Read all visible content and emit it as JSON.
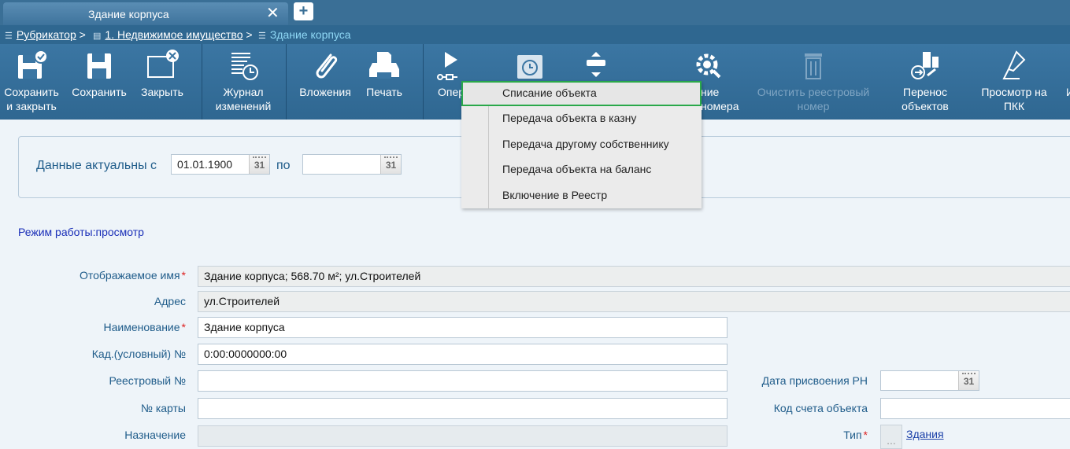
{
  "tab": {
    "title": "Здание корпуса",
    "close": "✕",
    "add": "+"
  },
  "breadcrumb": [
    {
      "label": "Рубрикатор",
      "sep": ">"
    },
    {
      "label": "1. Недвижимое имущество",
      "sep": ">"
    },
    {
      "label": "Здание корпуса"
    }
  ],
  "toolbar": {
    "save_close": "Сохранить\nи закрыть",
    "save": "Сохранить",
    "close": "Закрыть",
    "journal": "Журнал\nизменений",
    "attachments": "Вложения",
    "print": "Печать",
    "operations": "Опер",
    "assign_number": "ние\nномера",
    "clear_number": "Очистить реестровый\nномер",
    "move_objects": "Перенос\nобъектов",
    "view_pkk": "Просмотр на\nПКК",
    "more": "И"
  },
  "filter": {
    "label": "Данные актуальны с",
    "from_value": "01.01.1900",
    "to_label": "по",
    "to_value": "",
    "cal_text": "31"
  },
  "mode": "Режим работы:просмотр",
  "form": {
    "display_name": {
      "label": "Отображаемое имя",
      "value": "Здание корпуса; 568.70 м²; ул.Строителей"
    },
    "address": {
      "label": "Адрес",
      "value": "ул.Строителей"
    },
    "name": {
      "label": "Наименование",
      "value": "Здание корпуса"
    },
    "cadastral": {
      "label": "Кад.(условный) №",
      "value": "0:00:0000000:00"
    },
    "registry_no": {
      "label": "Реестровый №",
      "value": ""
    },
    "card_no": {
      "label": "№ карты",
      "value": ""
    },
    "purpose": {
      "label": "Назначение",
      "value": ""
    },
    "reg_date": {
      "label": "Дата присвоения РН",
      "value": ""
    },
    "account_code": {
      "label": "Код счета объекта",
      "value": ""
    },
    "type": {
      "label": "Тип",
      "value": "Здания",
      "dots": "..."
    },
    "required_mark": "*"
  },
  "menu": {
    "items": [
      "Списание объекта",
      "Передача объекта в казну",
      "Передача другому собственнику",
      "Передача объекта на баланс",
      "Включение в Реестр"
    ],
    "active_index": 0
  },
  "colors": {
    "accent": "#2f6790",
    "menu_active_border": "#2aa84a",
    "required": "#dd2222"
  }
}
